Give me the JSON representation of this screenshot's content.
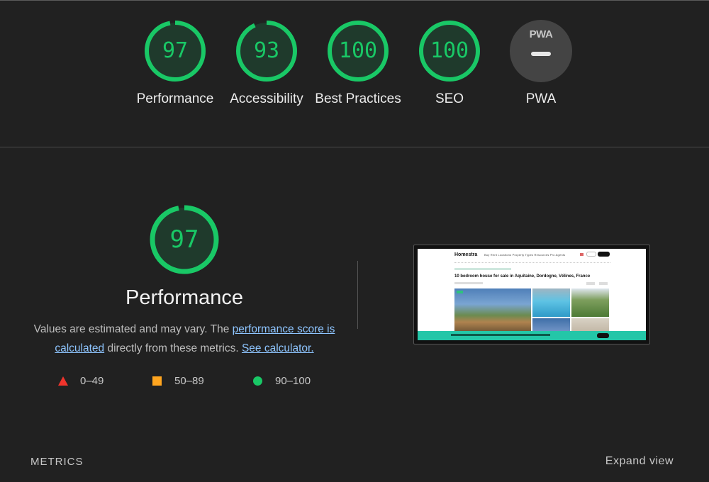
{
  "categories": [
    {
      "score": 97,
      "label": "Performance",
      "color": "#19c866"
    },
    {
      "score": 93,
      "label": "Accessibility",
      "color": "#19c866"
    },
    {
      "score": 100,
      "label": "Best Practices",
      "color": "#19c866"
    },
    {
      "score": 100,
      "label": "SEO",
      "color": "#19c866"
    },
    {
      "label": "PWA",
      "badge_text": "PWA",
      "badge_icon": "pwa-dash-icon"
    }
  ],
  "performance": {
    "score": 97,
    "title": "Performance",
    "desc_prefix": "Values are estimated and may vary. The ",
    "score_link": "performance score is calculated",
    "desc_middle": " directly from these metrics. ",
    "calc_link": "See calculator."
  },
  "legend": [
    {
      "shape": "triangle",
      "range": "0–49",
      "color": "#f0342c"
    },
    {
      "shape": "square",
      "range": "50–89",
      "color": "#ffa51f"
    },
    {
      "shape": "circle",
      "range": "90–100",
      "color": "#19c866"
    }
  ],
  "screenshot": {
    "logo": "Homestra",
    "nav": "Buy   Rent   Locations   Property Types   Resources   Pro Agents",
    "title": "10 bedroom house for sale in Aquitaine, Dordogne, Vélines, France"
  },
  "metrics": {
    "title": "METRICS",
    "expand": "Expand view"
  }
}
